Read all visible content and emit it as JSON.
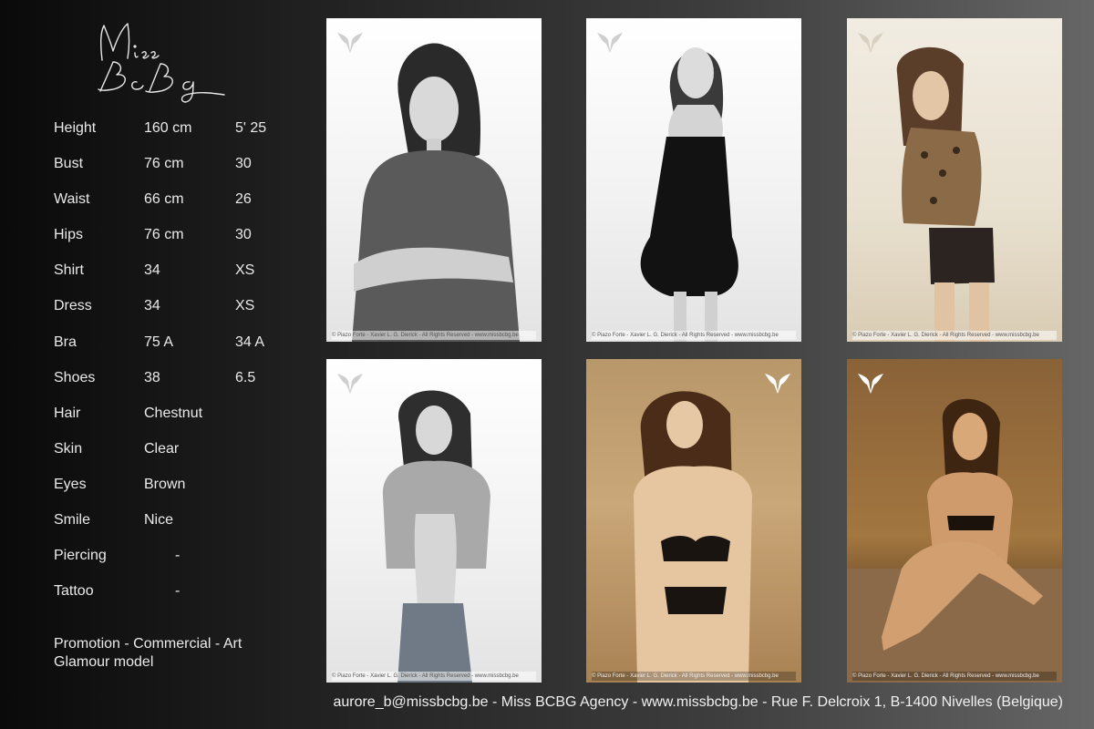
{
  "logo": {
    "text": "Miss BcBg"
  },
  "measurements": [
    {
      "label": "Height",
      "metric": "160 cm",
      "imperial": "5' 25"
    },
    {
      "label": "Bust",
      "metric": "76 cm",
      "imperial": "30"
    },
    {
      "label": "Waist",
      "metric": "66 cm",
      "imperial": "26"
    },
    {
      "label": "Hips",
      "metric": "76 cm",
      "imperial": "30"
    },
    {
      "label": "Shirt",
      "metric": "34",
      "imperial": "XS"
    },
    {
      "label": "Dress",
      "metric": "34",
      "imperial": "XS"
    },
    {
      "label": "Bra",
      "metric": "75 A",
      "imperial": "34 A"
    },
    {
      "label": "Shoes",
      "metric": "38",
      "imperial": "6.5"
    },
    {
      "label": "Hair",
      "metric": "Chestnut",
      "imperial": ""
    },
    {
      "label": "Skin",
      "metric": "Clear",
      "imperial": ""
    },
    {
      "label": "Eyes",
      "metric": "Brown",
      "imperial": ""
    },
    {
      "label": "Smile",
      "metric": "Nice",
      "imperial": ""
    },
    {
      "label": "Piercing",
      "metric": "-",
      "imperial": ""
    },
    {
      "label": "Tattoo",
      "metric": "-",
      "imperial": ""
    }
  ],
  "tagline": {
    "line1": "Promotion - Commercial - Art",
    "line2": "Glamour model"
  },
  "photos": [
    {
      "credit": "© Piazo Forte - Xavier L. G. Dierick - All Rights Reserved - www.missbcbg.be"
    },
    {
      "credit": "© Piazo Forte - Xavier L. G. Dierick - All Rights Reserved - www.missbcbg.be"
    },
    {
      "credit": "© Piazo Forte - Xavier L. G. Dierick - All Rights Reserved - www.missbcbg.be"
    },
    {
      "credit": "© Piazo Forte - Xavier L. G. Dierick - All Rights Reserved - www.missbcbg.be"
    },
    {
      "credit": "© Piazo Forte - Xavier L. G. Dierick - All Rights Reserved - www.missbcbg.be"
    },
    {
      "credit": "© Piazo Forte - Xavier L. G. Dierick - All Rights Reserved - www.missbcbg.be"
    }
  ],
  "footer": {
    "text": "aurore_b@missbcbg.be - Miss BCBG Agency - www.missbcbg.be - Rue F. Delcroix 1, B-1400 Nivelles (Belgique)"
  },
  "colors": {
    "accent": "#eaeaea",
    "background_dark": "#0a0a0a",
    "background_light": "#666666"
  }
}
